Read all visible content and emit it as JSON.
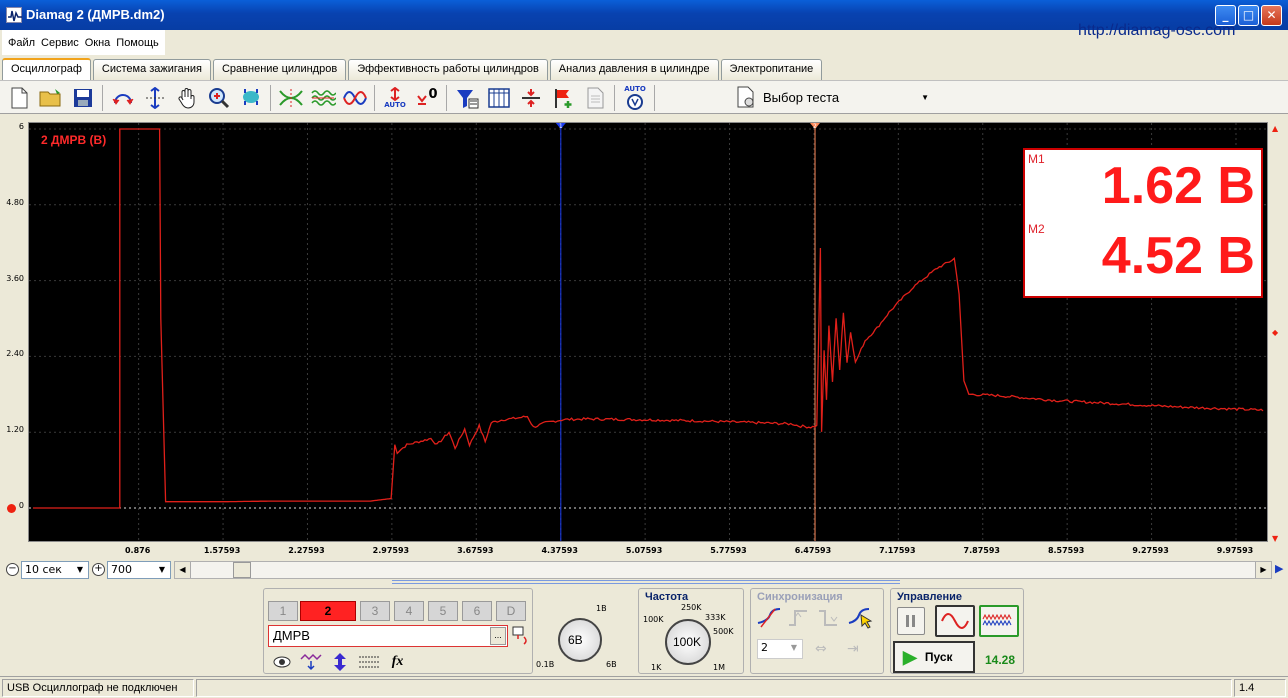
{
  "window": {
    "title": "Diamag 2 (ДМРВ.dm2)",
    "minimize": "_",
    "maximize": "□",
    "close": "✕"
  },
  "menu": [
    "Файл",
    "Сервис",
    "Окна",
    "Помощь"
  ],
  "url": "http://diamag-osc.com",
  "tabs": [
    "Осциллограф",
    "Система зажигания",
    "Сравнение цилиндров",
    "Эффективность работы цилиндров",
    "Анализ давления в цилиндре",
    "Электропитание"
  ],
  "toolbar": {
    "icons": [
      "new-file-icon",
      "open-folder-icon",
      "save-icon",
      "horizontal-stretch-icon",
      "vertical-stretch-icon",
      "hand-pan-icon",
      "zoom-in-icon",
      "fit-icon",
      "cross-cursor-icon",
      "waves-icon",
      "sine-icon",
      "auto-scale-icon",
      "zero-icon",
      "filter-icon",
      "table-icon",
      "split-icon",
      "flag-add-icon",
      "report-icon",
      "auto-volt-icon"
    ],
    "auto_label": "AUTO",
    "zero_label": "0",
    "test_select": "Выбор теста"
  },
  "scope": {
    "channel_label": "2 ДМРВ (В)",
    "y_ticks": [
      "6",
      "4.80",
      "3.60",
      "2.40",
      "1.20",
      "0"
    ],
    "x_ticks": [
      "0.876",
      "1.57593",
      "2.27593",
      "2.97593",
      "3.67593",
      "4.37593",
      "5.07593",
      "5.77593",
      "6.47593",
      "7.17593",
      "7.87593",
      "8.57593",
      "9.27593",
      "9.97593"
    ],
    "marker1_label": "1",
    "marker2_label": "2",
    "trace_color": "#e0201a",
    "marker1_color": "#1a3cf0",
    "marker2_color": "#ff8a5a",
    "trace_points": [
      [
        0.0,
        0.0
      ],
      [
        0.72,
        0.0
      ],
      [
        0.72,
        6.0
      ],
      [
        1.05,
        6.0
      ],
      [
        1.06,
        3.0
      ],
      [
        1.1,
        0.1
      ],
      [
        1.3,
        0.1
      ],
      [
        1.6,
        0.1
      ],
      [
        2.0,
        0.11
      ],
      [
        2.4,
        0.11
      ],
      [
        2.8,
        0.11
      ],
      [
        2.97,
        0.15
      ],
      [
        3.0,
        1.0
      ],
      [
        3.02,
        0.88
      ],
      [
        3.1,
        1.0
      ],
      [
        3.2,
        1.05
      ],
      [
        3.3,
        1.1
      ],
      [
        3.35,
        1.0
      ],
      [
        3.45,
        1.2
      ],
      [
        3.5,
        0.95
      ],
      [
        3.58,
        1.25
      ],
      [
        3.62,
        1.0
      ],
      [
        3.7,
        1.3
      ],
      [
        3.75,
        1.05
      ],
      [
        3.8,
        1.35
      ],
      [
        3.9,
        1.4
      ],
      [
        4.0,
        1.42
      ],
      [
        4.1,
        1.45
      ],
      [
        4.15,
        1.28
      ],
      [
        4.25,
        1.35
      ],
      [
        4.4,
        1.4
      ],
      [
        4.6,
        1.41
      ],
      [
        5.0,
        1.4
      ],
      [
        5.5,
        1.38
      ],
      [
        6.0,
        1.35
      ],
      [
        6.3,
        1.33
      ],
      [
        6.35,
        1.3
      ],
      [
        6.45,
        1.28
      ],
      [
        6.5,
        1.3
      ],
      [
        6.53,
        4.1
      ],
      [
        6.54,
        1.2
      ],
      [
        6.56,
        2.5
      ],
      [
        6.58,
        1.7
      ],
      [
        6.6,
        2.9
      ],
      [
        6.63,
        2.0
      ],
      [
        6.66,
        3.0
      ],
      [
        6.69,
        2.2
      ],
      [
        6.72,
        3.1
      ],
      [
        6.75,
        2.3
      ],
      [
        6.78,
        2.8
      ],
      [
        6.82,
        2.3
      ],
      [
        6.9,
        2.65
      ],
      [
        7.0,
        2.85
      ],
      [
        7.1,
        3.1
      ],
      [
        7.2,
        3.3
      ],
      [
        7.3,
        3.5
      ],
      [
        7.4,
        3.65
      ],
      [
        7.5,
        3.8
      ],
      [
        7.6,
        3.9
      ],
      [
        7.64,
        3.95
      ],
      [
        7.68,
        3.4
      ],
      [
        7.72,
        2.0
      ],
      [
        7.76,
        1.8
      ],
      [
        8.0,
        1.78
      ],
      [
        8.5,
        1.7
      ],
      [
        9.0,
        1.65
      ],
      [
        9.5,
        1.6
      ],
      [
        10.2,
        1.55
      ]
    ]
  },
  "readout": {
    "m1_label": "M1",
    "m1_value": "1.62 В",
    "m2_label": "M2",
    "m2_value": "4.52 В"
  },
  "timebase": {
    "value": "10 сек",
    "samples": "700"
  },
  "channels": {
    "buttons": [
      "1",
      "2",
      "3",
      "4",
      "5",
      "6",
      "D"
    ],
    "active": "2",
    "name": "ДМРВ",
    "browse": "..."
  },
  "volt_knob": {
    "value": "6В",
    "min": "0.1В",
    "max": "6В",
    "top": "1В"
  },
  "frequency": {
    "title": "Частота",
    "value": "100K",
    "labels": [
      "100K",
      "250K",
      "333K",
      "500K",
      "1K",
      "1M"
    ]
  },
  "sync": {
    "title": "Синхронизация",
    "value": "2"
  },
  "control": {
    "title": "Управление",
    "start": "Пуск",
    "counter": "14.28"
  },
  "status": {
    "text": "USB Осциллограф не подключен",
    "zoom": "1.4"
  }
}
